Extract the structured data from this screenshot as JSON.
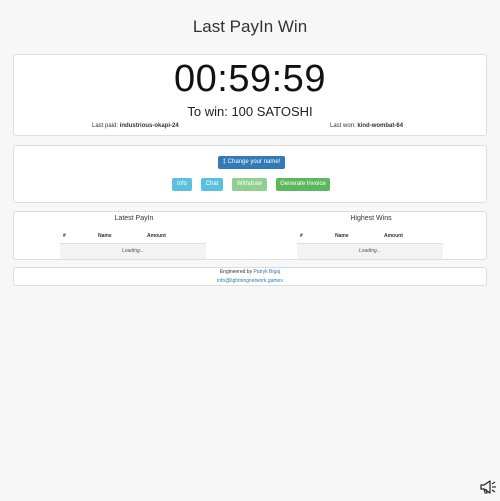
{
  "header": {
    "title": "Last PayIn Win"
  },
  "game": {
    "timer": "00:59:59",
    "to_win": "To win: 100 SATOSHI",
    "last_paid_label": "Last paid:",
    "last_paid_value": "industrious-okapi-24",
    "last_won_label": "Last won:",
    "last_won_value": "kind-wombat-64"
  },
  "actions": {
    "change_name": "‡ Change your name!",
    "info": "Info",
    "chat": "Chat",
    "withdraw": "Withdraw",
    "generate_invoice": "Generate Invoice"
  },
  "tables": {
    "latest": {
      "title": "Latest PayIn",
      "columns": [
        "#",
        "Name",
        "Amount"
      ],
      "status": "Loading..."
    },
    "highest": {
      "title": "Highest Wins",
      "columns": [
        "#",
        "Name",
        "Amount"
      ],
      "status": "Loading..."
    }
  },
  "footer": {
    "engineered_by": "Engineered by",
    "author": "Patryk Bigaj",
    "email": "info@lightningnetwork.games"
  },
  "colors": {
    "primary": "#337ab7",
    "info": "#5bc0de",
    "success": "#5cb85c",
    "success_disabled": "#8fcf8f"
  },
  "icons": {
    "corner": "megaphone-icon"
  }
}
